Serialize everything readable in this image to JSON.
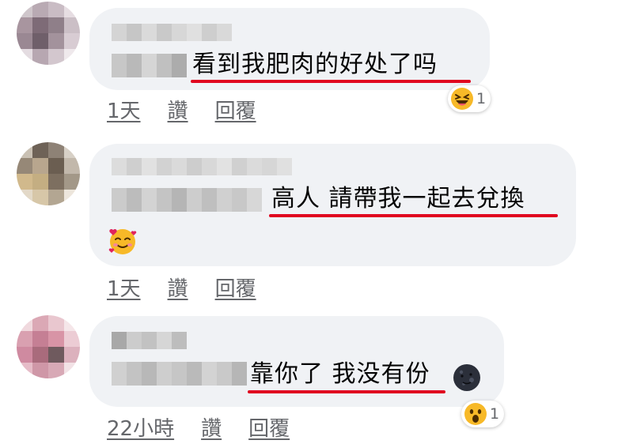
{
  "comments": [
    {
      "text": "看到我肥肉的好处了吗",
      "time": "1天",
      "like": "讚",
      "reply": "回覆",
      "reaction_icon": "laughing-face-icon",
      "reaction_count": "1"
    },
    {
      "text": "高人 請帶我一起去兌換",
      "emoji_icon": "smiling-face-with-hearts-icon",
      "time": "1天",
      "like": "讚",
      "reply": "回覆"
    },
    {
      "text": "靠你了 我没有份",
      "emoji_icon": "new-moon-face-icon",
      "time": "22小時",
      "like": "讚",
      "reply": "回覆",
      "reaction_icon": "surprised-face-icon",
      "reaction_count": "1"
    }
  ],
  "colors": {
    "bubble": "#f0f2f5",
    "underline": "#e0061f",
    "meta_text": "#65676b"
  }
}
